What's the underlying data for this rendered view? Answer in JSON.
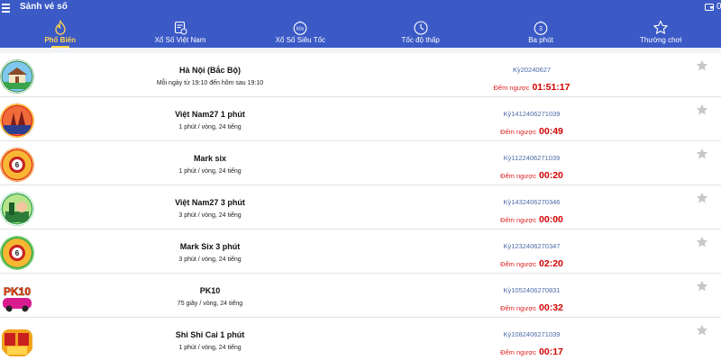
{
  "header": {
    "title": "Sảnh vé số",
    "balance": "0"
  },
  "tabs": [
    {
      "label": "Phổ Biến",
      "icon": "fire-icon",
      "active": true
    },
    {
      "label": "Xổ Số Việt Nam",
      "icon": "lottery-ticket-icon"
    },
    {
      "label": "Xổ Số Siêu Tốc",
      "icon": "60s-icon"
    },
    {
      "label": "Tốc độ thấp",
      "icon": "clock-icon"
    },
    {
      "label": "Ba phút",
      "icon": "timer-3-icon"
    },
    {
      "label": "Thường chơi",
      "icon": "star-icon"
    }
  ],
  "countdown_label": "Đếm ngược",
  "colors": {
    "primary": "#3b5ac6",
    "active": "#ffd44d",
    "countdown": "#d40000",
    "period": "#4a6aa8"
  },
  "games": [
    {
      "name": "Hà Nội (Bắc Bộ)",
      "schedule": "Mỗi ngày từ 19:10 đến hôm sau 19:10",
      "period": "Kỳ20240627",
      "countdown": "01:51:17",
      "logo": "hanoi-logo"
    },
    {
      "name": "Việt Nam27 1 phút",
      "schedule": "1 phút / vòng, 24 tiếng",
      "period": "Kỳ1412406271039",
      "countdown": "00:49",
      "logo": "vietnam27-logo"
    },
    {
      "name": "Mark six",
      "schedule": "1 phút / vòng, 24 tiếng",
      "period": "Kỳ1122406271039",
      "countdown": "00:20",
      "logo": "mark-six-logo"
    },
    {
      "name": "Việt Nam27 3 phút",
      "schedule": "3 phút / vòng, 24 tiếng",
      "period": "Kỳ1432406270346",
      "countdown": "00:00",
      "logo": "vietnam27-3-logo"
    },
    {
      "name": "Mark Six 3 phút",
      "schedule": "3 phút / vòng, 24 tiếng",
      "period": "Kỳ1232406270347",
      "countdown": "02:20",
      "logo": "mark-six-3-logo"
    },
    {
      "name": "PK10",
      "schedule": "75 giây / vòng, 24 tiếng",
      "period": "Kỳ1052406270831",
      "countdown": "00:32",
      "logo": "pk10-logo"
    },
    {
      "name": "Shi Shi Cai 1 phút",
      "schedule": "1 phút / vòng, 24 tiếng",
      "period": "Kỳ1082406271039",
      "countdown": "00:17",
      "logo": "shi-shi-cai-logo"
    }
  ]
}
